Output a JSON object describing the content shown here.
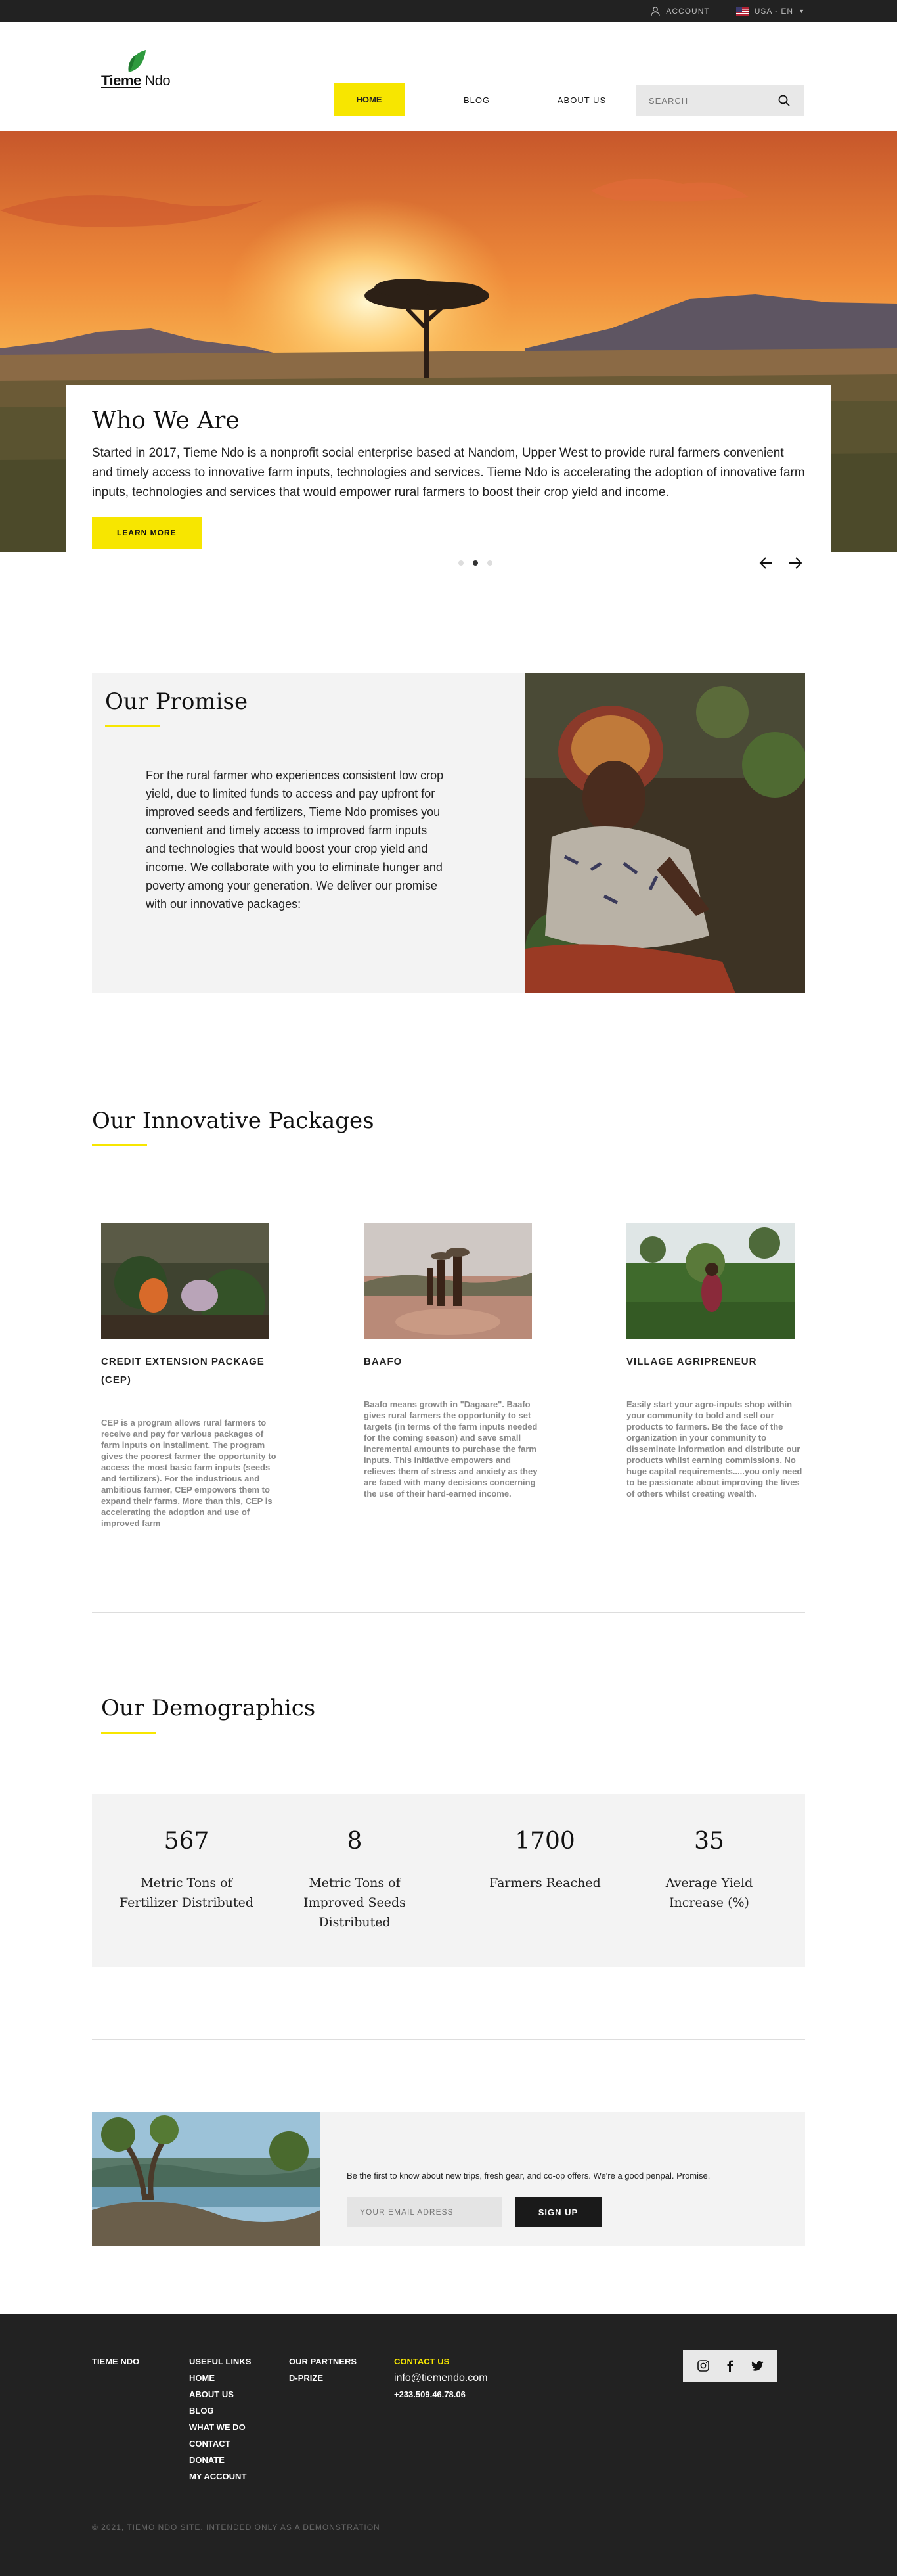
{
  "topbar": {
    "account": "ACCOUNT",
    "locale": "USA - EN"
  },
  "logo": {
    "brand": "Tieme",
    "brand2": "Ndo"
  },
  "nav": {
    "home": "HOME",
    "blog": "BLOG",
    "about": "ABOUT US"
  },
  "search": {
    "placeholder": "SEARCH"
  },
  "hero": {
    "title": "Who We Are",
    "body": "Started in 2017, Tieme Ndo is a nonprofit social enterprise based at Nandom, Upper West to provide rural farmers convenient and timely access to innovative farm inputs, technologies and services. Tieme Ndo is accelerating the adoption of innovative farm inputs, technologies and services that would empower rural farmers to boost their crop yield and income.",
    "cta": "LEARN MORE"
  },
  "promise": {
    "title": "Our Promise",
    "body": "For the rural farmer who experiences consistent low crop yield, due to limited funds to access and pay upfront for improved seeds and fertilizers, Tieme Ndo promises you convenient and timely access to improved farm inputs and technologies that would boost your crop yield and income. We collaborate with you to eliminate hunger and poverty among your generation. We deliver our promise with our innovative packages:"
  },
  "packages": {
    "title": "Our Innovative Packages",
    "items": [
      {
        "title": "CREDIT EXTENSION PACKAGE (CEP)",
        "body": "CEP is a program allows rural farmers to receive and pay for various packages of farm inputs on installment. The program gives the poorest farmer the opportunity to access the most basic farm inputs (seeds and fertilizers). For the industrious and ambitious farmer, CEP empowers them to expand their farms. More than this, CEP is accelerating the adoption and use of improved farm"
      },
      {
        "title": "BAAFO",
        "body": "Baafo means growth in \"Dagaare\". Baafo gives rural farmers the opportunity to set targets (in terms of the farm inputs needed for the coming season) and save small incremental amounts to purchase the farm inputs. This initiative empowers and relieves them of stress and anxiety as they are faced with many decisions concerning the use of their hard-earned income."
      },
      {
        "title": "VILLAGE AGRIPRENEUR",
        "body": "Easily start your agro-inputs shop within your community to bold and sell our products to farmers. Be the face of the organization in your community to disseminate information and distribute our products whilst earning commissions. No huge capital requirements.....you only need to be passionate about improving the lives of others whilst creating wealth."
      }
    ]
  },
  "demographics": {
    "title": "Our Demographics",
    "stats": [
      {
        "value": "567",
        "label": "Metric Tons of Fertilizer Distributed"
      },
      {
        "value": "8",
        "label": "Metric Tons of Improved Seeds Distributed"
      },
      {
        "value": "1700",
        "label": "Farmers Reached"
      },
      {
        "value": "35",
        "label": "Average Yield Increase (%)"
      }
    ]
  },
  "newsletter": {
    "text": "Be the first to know about new trips, fresh gear, and co-op offers. We're a good penpal. Promise.",
    "placeholder": "YOUR EMAIL ADRESS",
    "button": "SIGN UP"
  },
  "footer": {
    "brand": "TIEME NDO",
    "useful_title": "USEFUL LINKS",
    "useful_links": [
      "HOME",
      "ABOUT US",
      "BLOG",
      "WHAT WE DO",
      "CONTACT",
      "DONATE",
      "MY ACCOUNT"
    ],
    "partners_title": "OUR PARTNERS",
    "partners": [
      "D-PRIZE"
    ],
    "contact_title": "CONTACT US",
    "email": "info@tiemendo.com",
    "phone": "+233.509.46.78.06",
    "copyright": "© 2021, TIEMO NDO SITE. INTENDED ONLY AS A DEMONSTRATION"
  },
  "colors": {
    "accent": "#f7e600",
    "dark": "#222222",
    "panel": "#f3f3f3"
  },
  "icons": [
    "user-icon",
    "flag-icon",
    "chevron-down-icon",
    "search-icon",
    "arrow-left-icon",
    "arrow-right-icon",
    "instagram-icon",
    "facebook-icon",
    "twitter-icon"
  ]
}
